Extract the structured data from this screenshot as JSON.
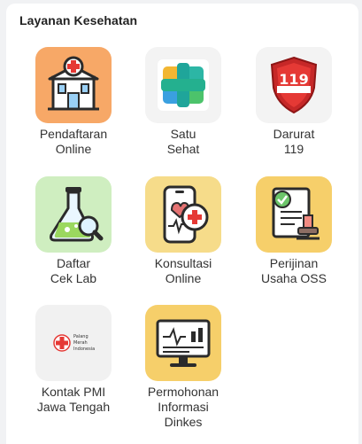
{
  "section": {
    "title": "Layanan Kesehatan"
  },
  "services": [
    {
      "line1": "Pendaftaran",
      "line2": "Online",
      "icon": "hospital-building-icon",
      "bg": "#f7a867"
    },
    {
      "line1": "Satu",
      "line2": "Sehat",
      "icon": "satu-sehat-logo-icon",
      "bg": "#f3f3f3"
    },
    {
      "line1": "Darurat",
      "line2": "119",
      "icon": "emergency-119-shield-icon",
      "bg": "#f3f3f3",
      "badge_text": "119"
    },
    {
      "line1": "Daftar",
      "line2": "Cek Lab",
      "icon": "lab-flask-icon",
      "bg": "#cfeec0"
    },
    {
      "line1": "Konsultasi",
      "line2": "Online",
      "icon": "phone-medical-icon",
      "bg": "#f6dc8a"
    },
    {
      "line1": "Perijinan",
      "line2": "Usaha OSS",
      "icon": "permit-stamp-icon",
      "bg": "#f6cf6a"
    },
    {
      "line1": "Kontak PMI",
      "line2": "Jawa Tengah",
      "icon": "pmi-logo-icon",
      "bg": "#f1f1f1",
      "logo_lines": [
        "Palang",
        "Merah",
        "Indonesia"
      ]
    },
    {
      "line1": "Permohonan",
      "line2": "Informasi",
      "line3": "Dinkes",
      "icon": "monitor-info-icon",
      "bg": "#f6cf6a"
    }
  ]
}
